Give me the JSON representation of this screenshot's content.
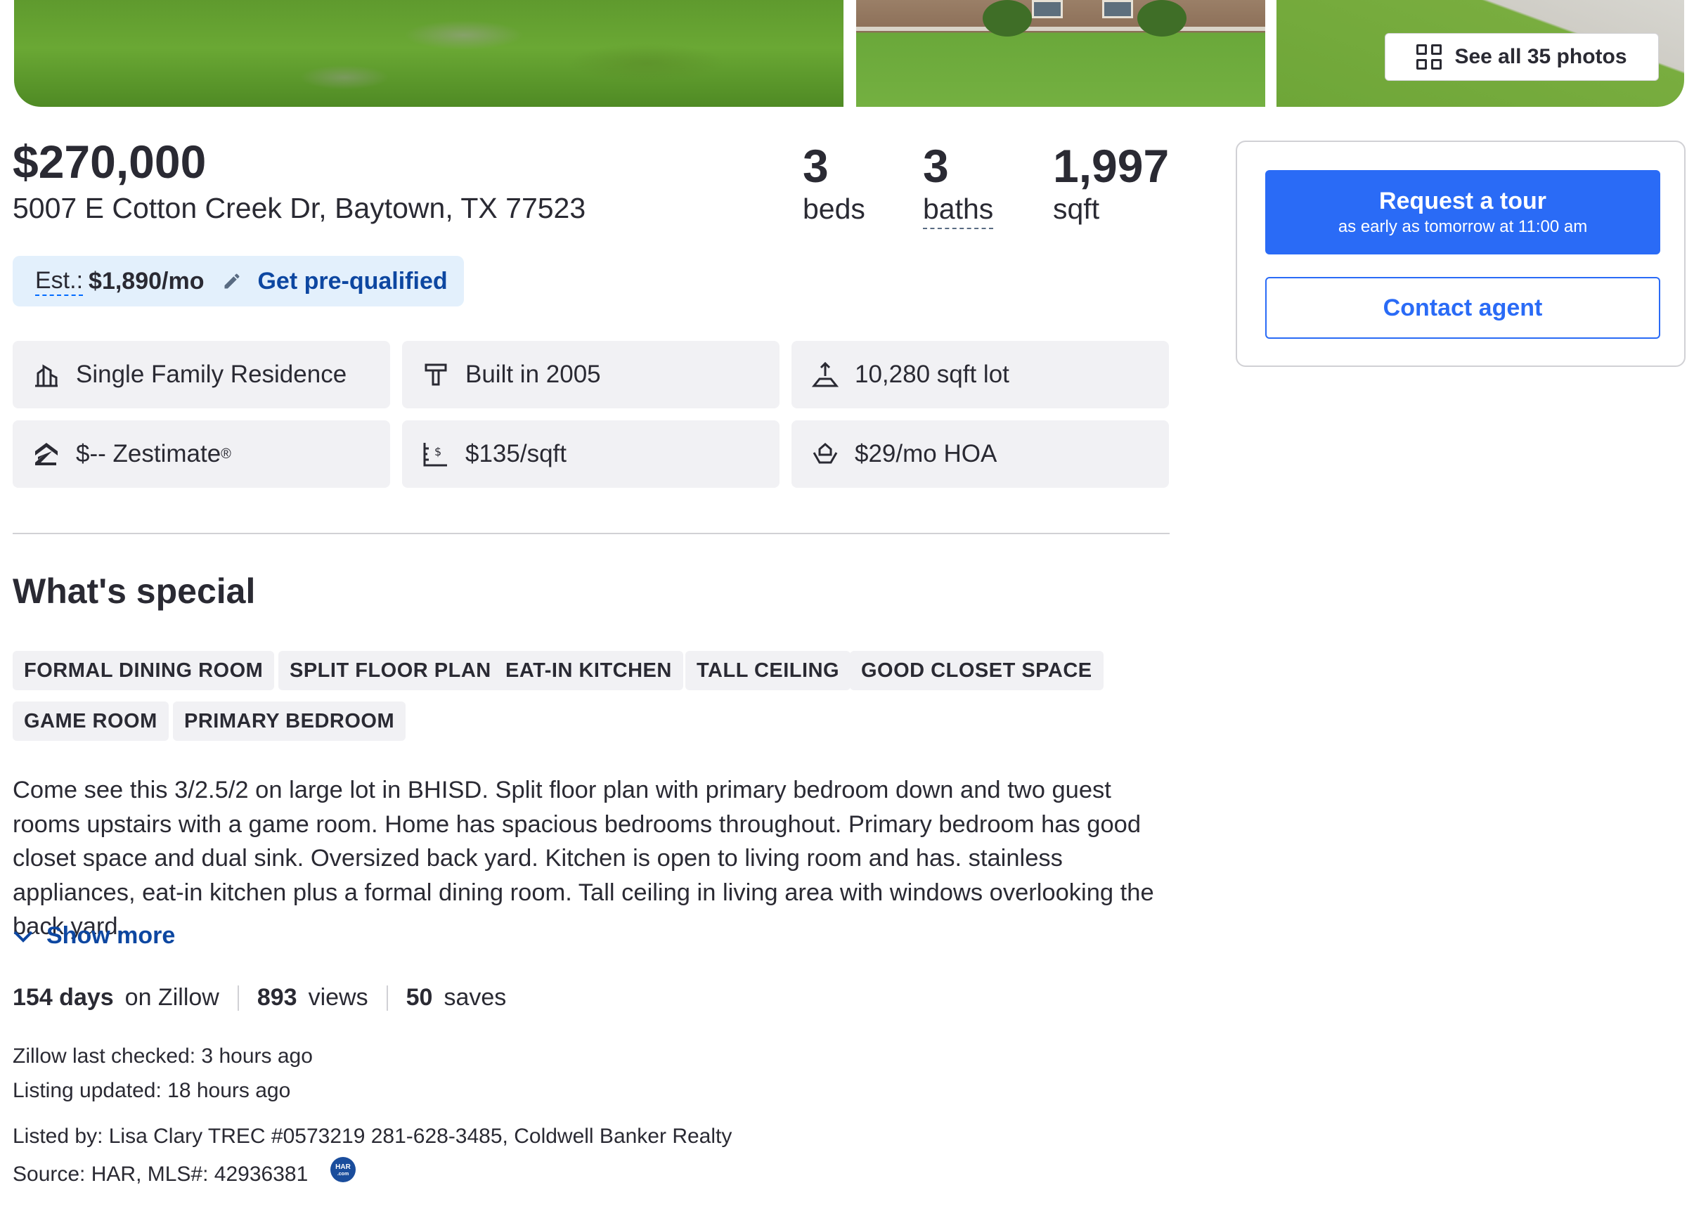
{
  "photos": {
    "see_all_label": "See all 35 photos"
  },
  "summary": {
    "price": "$270,000",
    "address": "5007 E Cotton Creek Dr, Baytown, TX 77523",
    "beds_value": "3",
    "beds_label": "beds",
    "baths_value": "3",
    "baths_label": "baths",
    "sqft_value": "1,997",
    "sqft_label": "sqft"
  },
  "estimate": {
    "label": "Est.:",
    "value": "$1,890/mo",
    "prequal_label": "Get pre-qualified"
  },
  "facts": {
    "home_type": "Single Family Residence",
    "year_built": "Built in 2005",
    "lot": "10,280 sqft lot",
    "zestimate": "$-- Zestimate",
    "zestimate_mark": "®",
    "price_per_sqft": "$135/sqft",
    "hoa": "$29/mo HOA"
  },
  "special": {
    "title": "What's special",
    "tags": [
      "FORMAL DINING ROOM",
      "SPLIT FLOOR PLAN",
      "EAT-IN KITCHEN",
      "TALL CEILING",
      "GOOD CLOSET SPACE",
      "GAME ROOM",
      "PRIMARY BEDROOM"
    ],
    "description": "Come see this 3/2.5/2 on large lot in BHISD.  Split floor plan with primary bedroom down and two guest rooms upstairs with a game room. Home has spacious bedrooms throughout. Primary bedroom has good closet space and dual sink. Oversized back yard. Kitchen is open to living room and has. stainless appliances, eat-in kitchen plus a formal dining room.  Tall ceiling in living area with windows overlooking the back yard.",
    "show_more_label": "Show more"
  },
  "activity": {
    "days_value": "154 days",
    "days_label": "on Zillow",
    "views_value": "893",
    "views_label": "views",
    "saves_value": "50",
    "saves_label": "saves"
  },
  "listing_meta": {
    "last_checked": "Zillow last checked: 3 hours ago",
    "updated": "Listing updated: 18 hours ago",
    "listed_by": "Listed by: Lisa Clary TREC #0573219 281-628-3485, Coldwell Banker Realty",
    "source": "Source: HAR,  MLS#: 42936381",
    "har_badge_top": "HAR",
    "har_badge_bottom": ".com"
  },
  "contact": {
    "tour_label": "Request a tour",
    "tour_sub": "as early as tomorrow at 11:00 am",
    "agent_label": "Contact agent"
  },
  "colors": {
    "primary_blue": "#2a6bf6",
    "link_blue": "#0d47a1",
    "estimate_bg": "#e3f0fc",
    "chip_bg": "#f1f1f4",
    "text": "#2a2a33"
  },
  "icons": {
    "home_type": "building-chart-icon",
    "year_built": "hammer-icon",
    "lot": "lot-size-icon",
    "zestimate": "zillow-logo-icon",
    "price_per_sqft": "price-ruler-icon",
    "hoa": "hands-house-icon",
    "see_all": "grid-icon",
    "estimate_edit": "pencil-icon",
    "show_more": "chevron-down-icon"
  }
}
